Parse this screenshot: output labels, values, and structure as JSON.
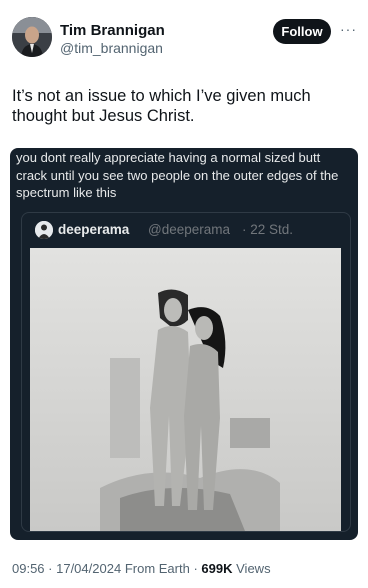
{
  "author": {
    "name": "Tim Brannigan",
    "handle": "@tim_brannigan",
    "follow_label": "Follow",
    "more_label": "···"
  },
  "tweet": {
    "text": "It’s not an issue to which I’ve given much thought but Jesus Christ."
  },
  "quoted_card": {
    "text": "you dont really appreciate having a normal sized butt crack until you see two people on the outer edges of the spectrum like this",
    "quote": {
      "name": "deeperama",
      "handle": "@deeperama",
      "time": "· 22 Std."
    }
  },
  "footer": {
    "time": "09:56",
    "date": "· 17/04/2024",
    "source": "From Earth",
    "views_count": "699K",
    "views_label": "Views",
    "sep": "·"
  },
  "colors": {
    "card_bg": "#15202b",
    "follow_bg": "#0f1419",
    "muted": "#536471"
  }
}
